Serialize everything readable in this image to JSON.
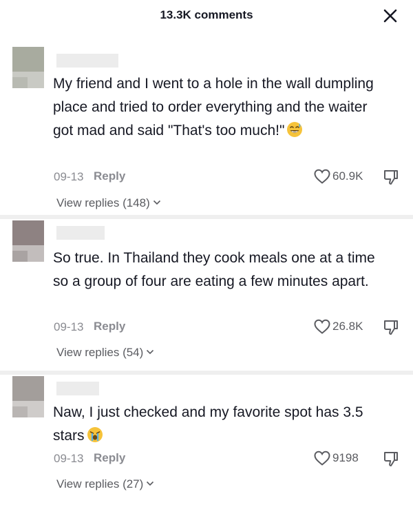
{
  "header": {
    "title": "13.3K comments",
    "close_icon": "close-icon"
  },
  "comments": [
    {
      "text": "My friend and I went to a hole in the wall dumpling place and tried to order everything and the waiter got mad and said \"That's too much!\"",
      "emoji": "grinning-sweat-emoji",
      "date": "09-13",
      "reply_label": "Reply",
      "likes": "60.9K",
      "view_replies": "View replies (148)"
    },
    {
      "text": "So true. In Thailand they cook meals one at a time so a group of four are eating a few minutes apart.",
      "date": "09-13",
      "reply_label": "Reply",
      "likes": "26.8K",
      "view_replies": "View replies (54)"
    },
    {
      "text": "Naw, I just checked and my favorite spot has 3.5 stars",
      "emoji": "crying-emoji",
      "date": "09-13",
      "reply_label": "Reply",
      "likes": "9198",
      "view_replies": "View replies (27)"
    }
  ]
}
